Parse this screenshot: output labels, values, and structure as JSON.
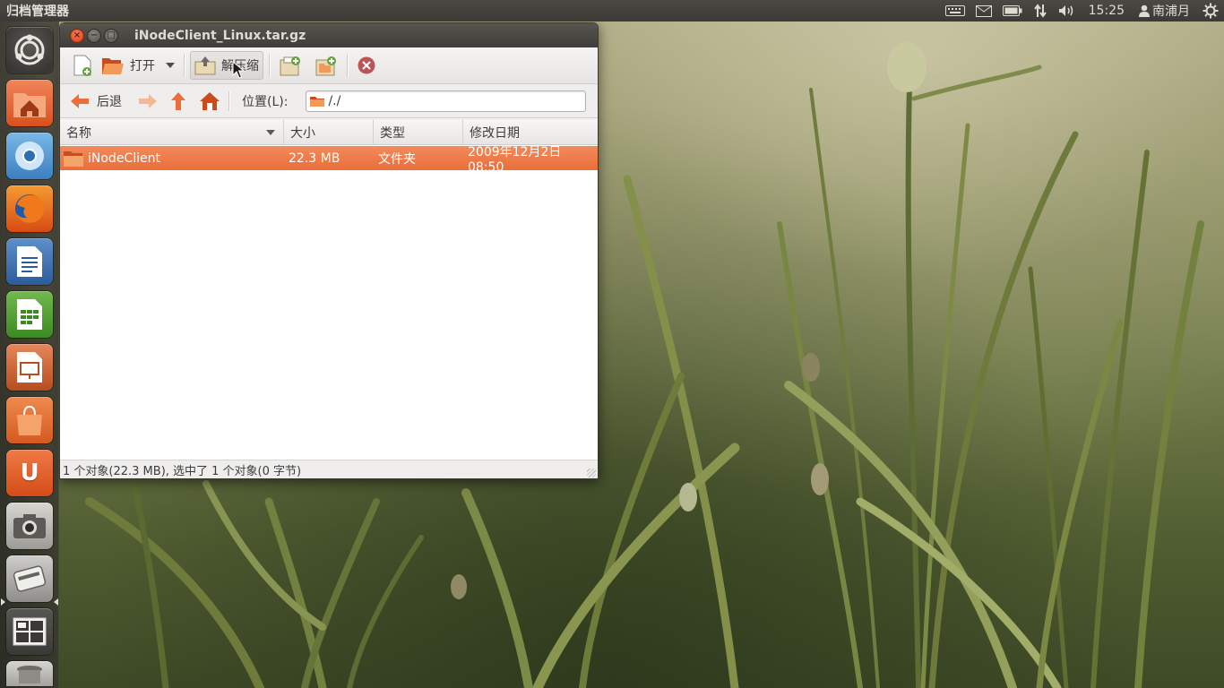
{
  "panel": {
    "app_title": "归档管理器",
    "clock": "15:25",
    "user": "南浦月",
    "indicators": [
      "keyboard-icon",
      "mail-icon",
      "battery-icon",
      "network-icon",
      "volume-icon",
      "power-gear-icon"
    ]
  },
  "launcher": {
    "items": [
      {
        "name": "dash-home",
        "icon": "ubuntu-logo-icon"
      },
      {
        "name": "home-folder",
        "icon": "home-folder-icon"
      },
      {
        "name": "chromium",
        "icon": "chromium-icon"
      },
      {
        "name": "firefox",
        "icon": "firefox-icon"
      },
      {
        "name": "libreoffice-writer",
        "icon": "writer-icon"
      },
      {
        "name": "libreoffice-calc",
        "icon": "calc-icon"
      },
      {
        "name": "libreoffice-impress",
        "icon": "impress-icon"
      },
      {
        "name": "software-center",
        "icon": "shopping-bag-icon"
      },
      {
        "name": "ubuntu-one",
        "icon": "ubuntu-one-icon",
        "glyph": "U"
      },
      {
        "name": "camera",
        "icon": "camera-icon"
      },
      {
        "name": "archive-manager",
        "icon": "archive-icon"
      },
      {
        "name": "workspace-switcher",
        "icon": "workspaces-icon"
      },
      {
        "name": "trash",
        "icon": "trash-icon"
      }
    ]
  },
  "window": {
    "title": "iNodeClient_Linux.tar.gz",
    "toolbar": {
      "open_label": "打开",
      "extract_label": "解压缩"
    },
    "nav": {
      "back_label": "后退",
      "location_label": "位置(L):",
      "location_value": "/./"
    },
    "columns": [
      "名称",
      "大小",
      "类型",
      "修改日期"
    ],
    "rows": [
      {
        "name": "iNodeClient",
        "size": "22.3 MB",
        "type": "文件夹",
        "modified": "2009年12月2日 08:50",
        "selected": true
      }
    ],
    "status": "1 个对象(22.3 MB), 选中了 1 个对象(0 字节)"
  },
  "colors": {
    "accent_orange": "#ea6f3a",
    "panel_dark": "#3b3a36",
    "close_button": "#e9532a"
  }
}
